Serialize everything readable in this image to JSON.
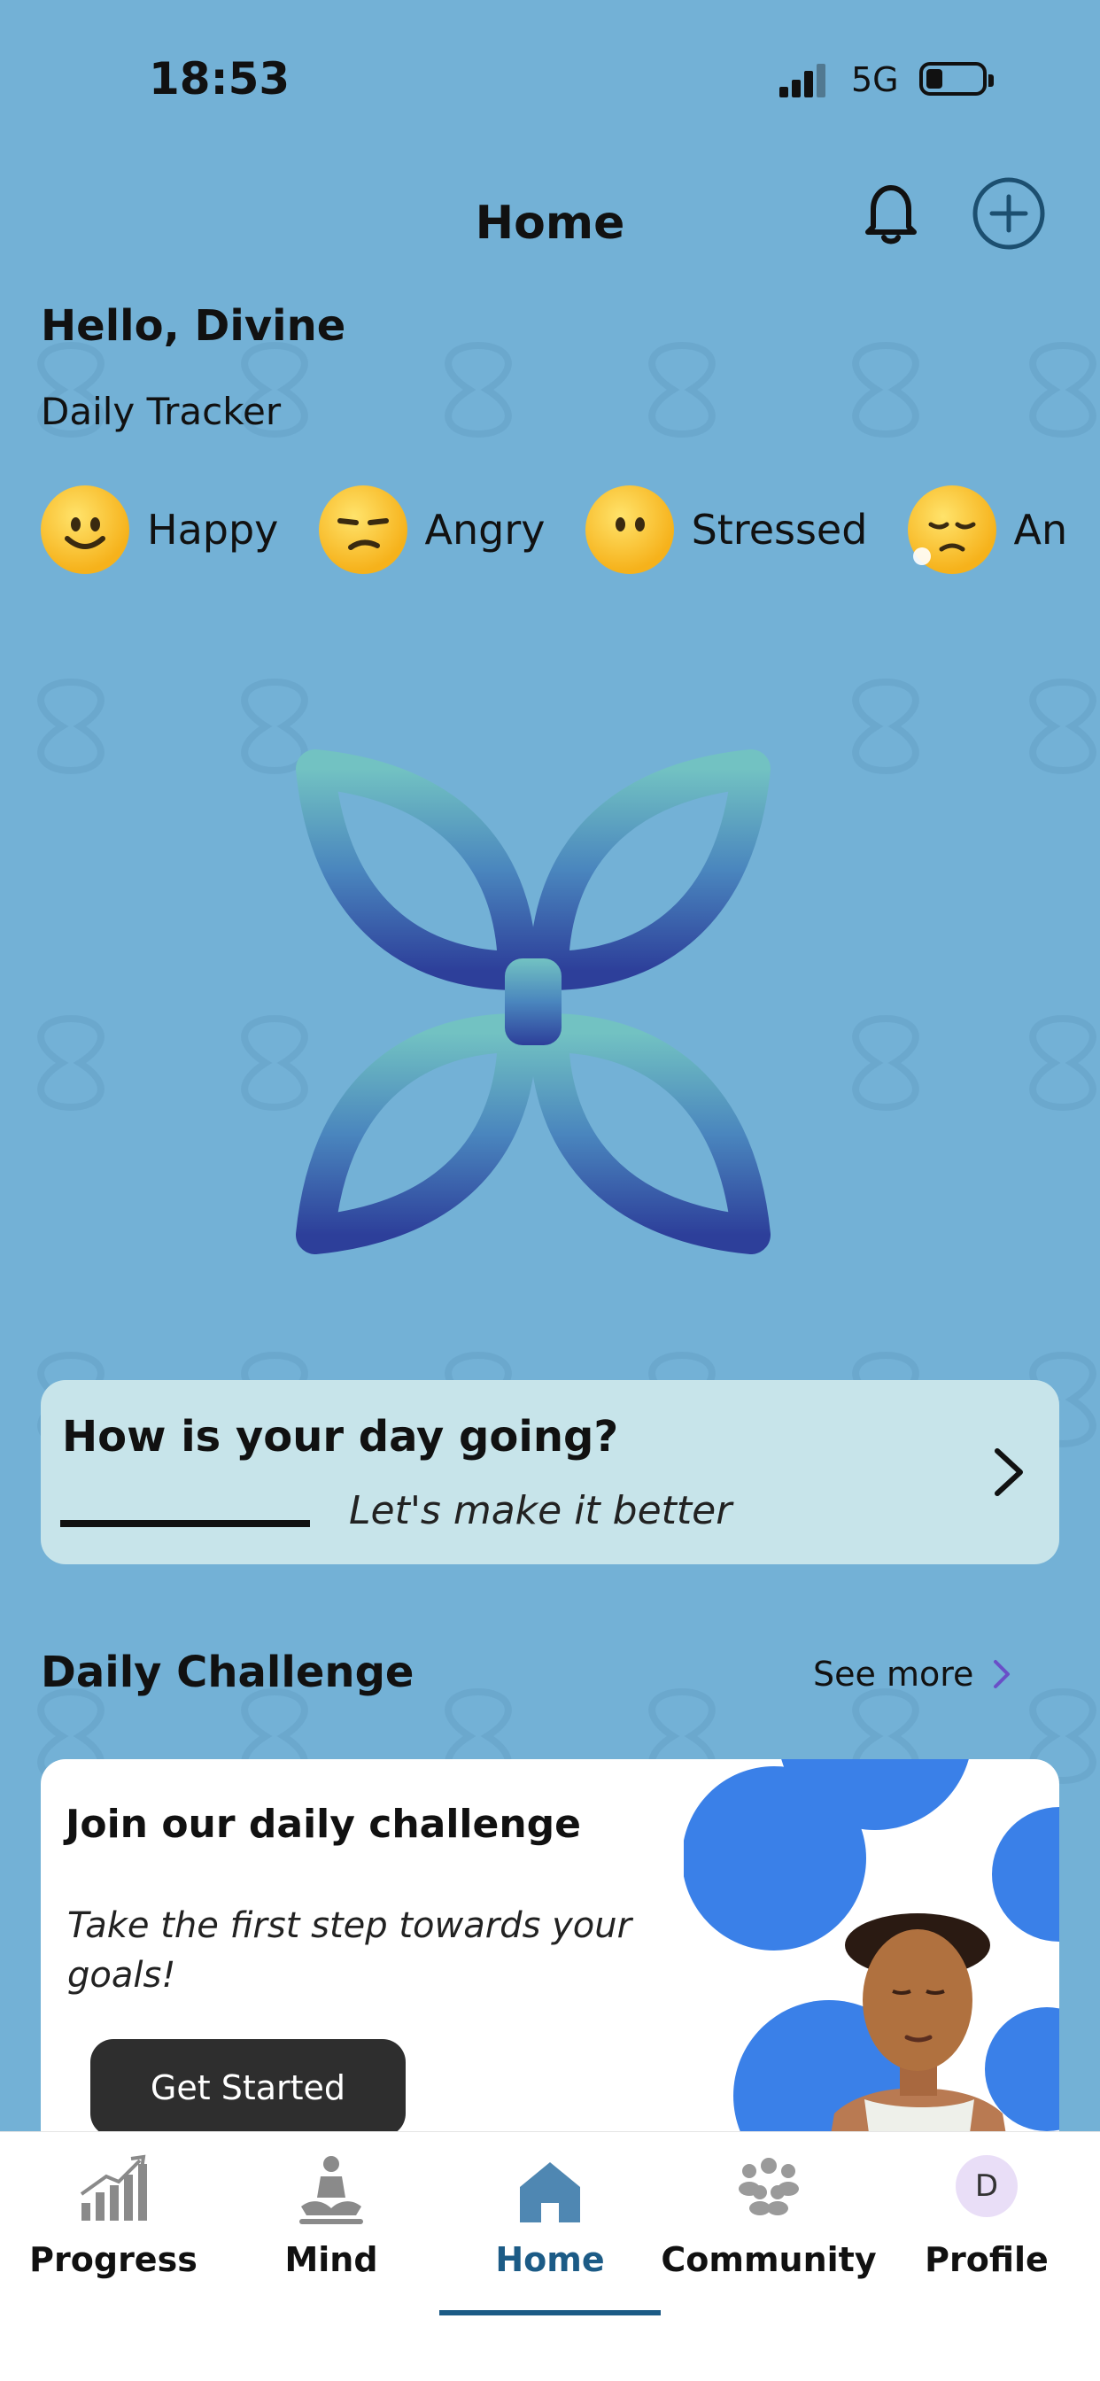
{
  "status_bar": {
    "time": "18:53",
    "network": "5G"
  },
  "header": {
    "title": "Home"
  },
  "greeting": "Hello, Divine",
  "tracker": {
    "title": "Daily Tracker",
    "moods": [
      {
        "label": "Happy",
        "icon": "smiling-face-icon"
      },
      {
        "label": "Angry",
        "icon": "unamused-face-icon"
      },
      {
        "label": "Stressed",
        "icon": "face-without-mouth-icon"
      },
      {
        "label": "An",
        "icon": "face-exhaling-icon"
      }
    ]
  },
  "day_card": {
    "title": "How is your day going?",
    "subtitle": "Let's make it better"
  },
  "challenge_section": {
    "title": "Daily Challenge",
    "see_more": "See more"
  },
  "challenge_card": {
    "title": "Join our daily challenge",
    "subtitle": "Take the first step towards your goals!",
    "button": "Get Started"
  },
  "tabs": [
    {
      "label": "Progress",
      "icon": "progress-chart-icon",
      "active": false
    },
    {
      "label": "Mind",
      "icon": "meditation-icon",
      "active": false
    },
    {
      "label": "Home",
      "icon": "home-icon",
      "active": true
    },
    {
      "label": "Community",
      "icon": "community-icon",
      "active": false
    },
    {
      "label": "Profile",
      "icon": "profile-avatar",
      "active": false,
      "avatar_initial": "D"
    }
  ],
  "colors": {
    "background": "#73b1d6",
    "card": "#c7e4ea",
    "active_tab": "#1c5b86",
    "challenge_circles": "#3a80e8"
  }
}
